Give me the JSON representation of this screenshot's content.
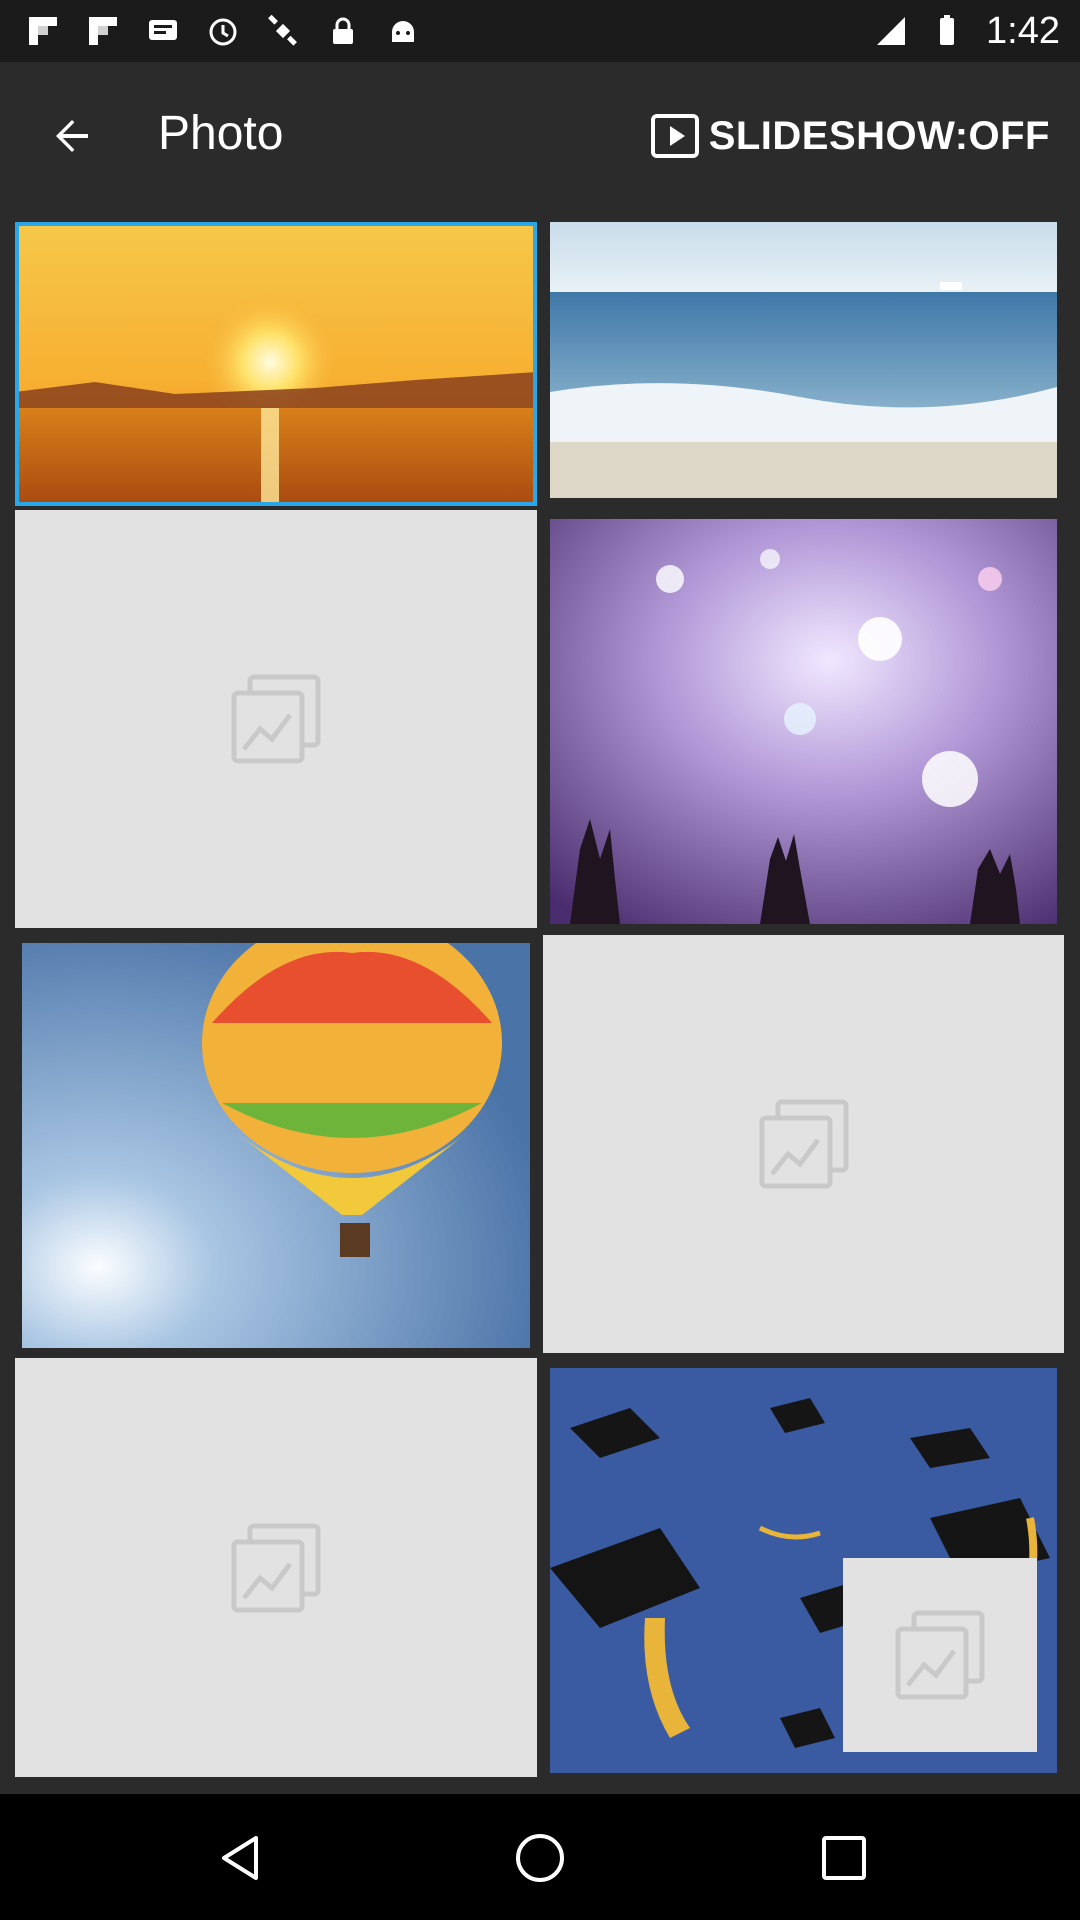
{
  "status_bar": {
    "time": "1:42",
    "left_icons": [
      "flipboard-icon",
      "flipboard-icon",
      "message-icon",
      "alarm-icon",
      "satellite-fake-icon",
      "lock-icon",
      "android-icon"
    ],
    "right_icons": [
      "signal-icon",
      "battery-icon"
    ]
  },
  "app_bar": {
    "title": "Photo",
    "back_icon": "arrow-back-icon",
    "slideshow_icon": "play-box-icon",
    "slideshow_label": "SLIDESHOW:OFF"
  },
  "grid": {
    "items": [
      {
        "type": "photo",
        "subject": "sunset over water",
        "selected": true
      },
      {
        "type": "photo",
        "subject": "beach waves",
        "selected": false
      },
      {
        "type": "placeholder",
        "icon": "image-placeholder-icon"
      },
      {
        "type": "photo",
        "subject": "concert crowd lights",
        "selected": false
      },
      {
        "type": "photo",
        "subject": "hot air balloon",
        "selected": false
      },
      {
        "type": "placeholder",
        "icon": "image-placeholder-icon"
      },
      {
        "type": "placeholder",
        "icon": "image-placeholder-icon"
      },
      {
        "type": "photo",
        "subject": "graduation caps",
        "selected": false
      }
    ],
    "accent_color": "#2aa7e8"
  },
  "nav_bar": {
    "icons": [
      "nav-back-icon",
      "nav-home-icon",
      "nav-recents-icon"
    ]
  }
}
